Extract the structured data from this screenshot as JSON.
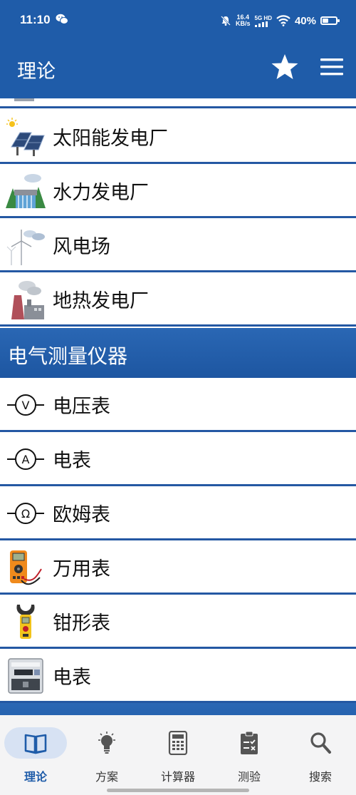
{
  "status_bar": {
    "time": "11:10",
    "speed_value": "16.4",
    "speed_unit": "KB/s",
    "network": "5G HD",
    "battery_percent": "40%"
  },
  "app_bar": {
    "title": "理论",
    "star_icon": "star-icon",
    "menu_icon": "menu-icon"
  },
  "list": {
    "power_plants": [
      {
        "label": "太阳能发电厂",
        "icon": "solar-panel-icon"
      },
      {
        "label": "水力发电厂",
        "icon": "hydro-dam-icon"
      },
      {
        "label": "风电场",
        "icon": "wind-turbine-icon"
      },
      {
        "label": "地热发电厂",
        "icon": "geothermal-plant-icon"
      }
    ],
    "section_title": "电气测量仪器",
    "instruments": [
      {
        "label": "电压表",
        "icon": "voltmeter-icon"
      },
      {
        "label": "电表",
        "icon": "ammeter-icon"
      },
      {
        "label": "欧姆表",
        "icon": "ohmmeter-icon"
      },
      {
        "label": "万用表",
        "icon": "multimeter-icon"
      },
      {
        "label": "钳形表",
        "icon": "clamp-meter-icon"
      },
      {
        "label": "电表",
        "icon": "electricity-meter-icon"
      }
    ]
  },
  "bottom_nav": {
    "items": [
      {
        "label": "理论",
        "icon": "book-icon",
        "active": true
      },
      {
        "label": "方案",
        "icon": "lightbulb-icon",
        "active": false
      },
      {
        "label": "计算器",
        "icon": "calculator-icon",
        "active": false
      },
      {
        "label": "测验",
        "icon": "clipboard-icon",
        "active": false
      },
      {
        "label": "搜索",
        "icon": "search-icon",
        "active": false
      }
    ]
  },
  "colors": {
    "primary": "#1f5ca9",
    "divider": "#2458a3",
    "nav_background": "#f4f4f5",
    "nav_active_pill": "#d7e2f3"
  }
}
